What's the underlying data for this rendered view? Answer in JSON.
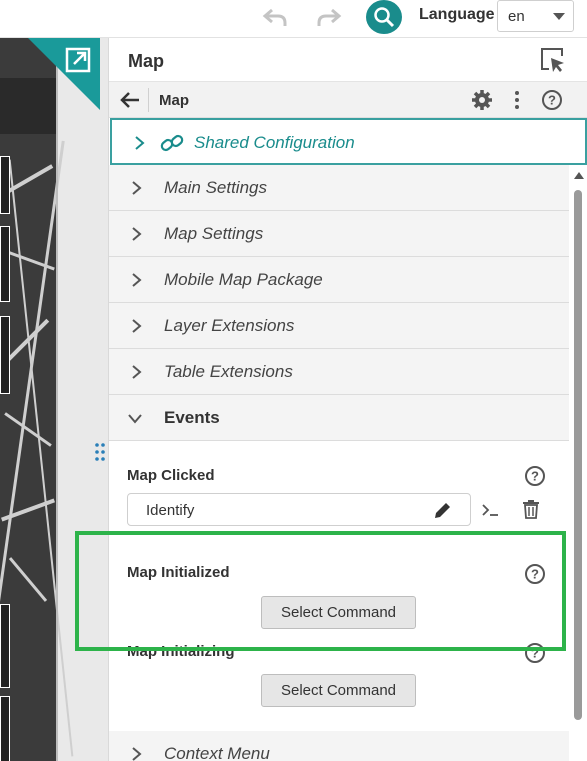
{
  "toolbar": {
    "language_label": "Language",
    "language_value": "en"
  },
  "panel": {
    "title": "Map",
    "breadcrumb": "Map",
    "sections": [
      {
        "label": "Shared Configuration"
      },
      {
        "label": "Main Settings"
      },
      {
        "label": "Map Settings"
      },
      {
        "label": "Mobile Map Package"
      },
      {
        "label": "Layer Extensions"
      },
      {
        "label": "Table Extensions"
      },
      {
        "label": "Events"
      },
      {
        "label": "Context Menu"
      }
    ],
    "events": {
      "map_clicked_label": "Map Clicked",
      "map_clicked_value": "Identify",
      "map_initialized_label": "Map Initialized",
      "map_initialized_button": "Select Command",
      "map_initializing_label": "Map Initializing",
      "map_initializing_button": "Select Command"
    }
  },
  "colors": {
    "accent": "#1a8c8c",
    "highlight": "#2db34a"
  },
  "icons": [
    "undo-icon",
    "redo-icon",
    "search-icon",
    "expand-icon",
    "cursor-select-icon",
    "back-arrow-icon",
    "gear-icon",
    "kebab-icon",
    "help-icon",
    "link-icon",
    "chevron-right-icon",
    "chevron-down-icon",
    "pencil-icon",
    "terminal-icon",
    "trash-icon",
    "grip-icon"
  ]
}
